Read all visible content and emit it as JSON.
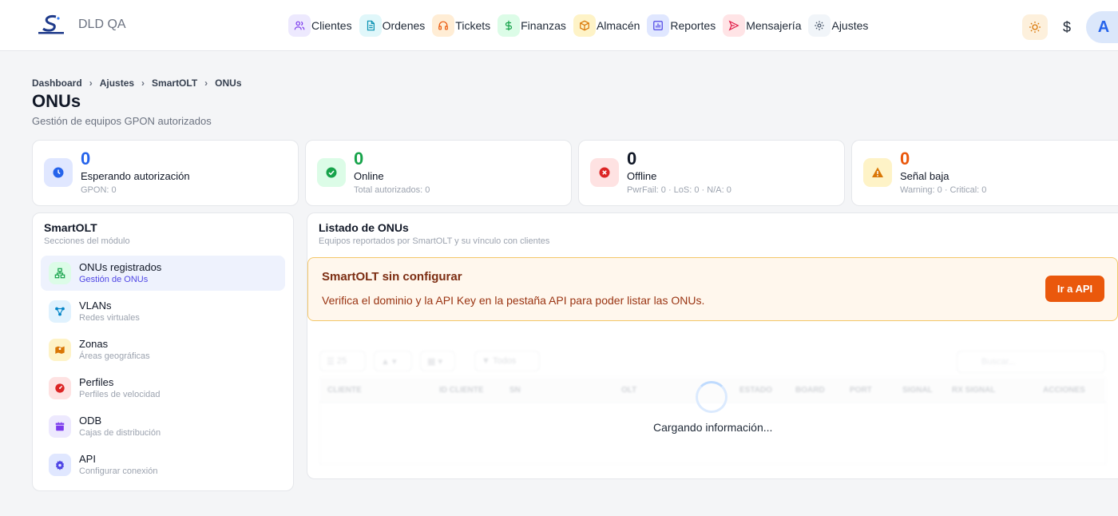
{
  "app": {
    "name": "DLD QA"
  },
  "nav": [
    {
      "label": "Clientes",
      "icon": "users-icon",
      "bg": "#ede9fe",
      "color": "#7c3aed"
    },
    {
      "label": "Ordenes",
      "icon": "document-icon",
      "bg": "#e0f7fa",
      "color": "#0891b2"
    },
    {
      "label": "Tickets",
      "icon": "headset-icon",
      "bg": "#ffedd5",
      "color": "#ea580c"
    },
    {
      "label": "Finanzas",
      "icon": "dollar-icon",
      "bg": "#dcfce7",
      "color": "#16a34a"
    },
    {
      "label": "Almacén",
      "icon": "box-icon",
      "bg": "#fef3c7",
      "color": "#d97706"
    },
    {
      "label": "Reportes",
      "icon": "bar-chart-icon",
      "bg": "#e0e7ff",
      "color": "#4f46e5"
    },
    {
      "label": "Mensajería",
      "icon": "send-icon",
      "bg": "#ffe4e6",
      "color": "#e11d48"
    },
    {
      "label": "Ajustes",
      "icon": "gear-icon",
      "bg": "#f1f5f9",
      "color": "#475569"
    }
  ],
  "topbar": {
    "dollar": "$",
    "avatar": "A"
  },
  "breadcrumb": [
    "Dashboard",
    "Ajustes",
    "SmartOLT",
    "ONUs"
  ],
  "page": {
    "title": "ONUs",
    "subtitle": "Gestión de equipos GPON autorizados"
  },
  "stats": [
    {
      "value": "0",
      "label": "Esperando autorización",
      "sub": "GPON: 0",
      "color": "#2563eb",
      "bg": "#e0e7ff",
      "icon": "clock-icon"
    },
    {
      "value": "0",
      "label": "Online",
      "sub": "Total autorizados: 0",
      "color": "#16a34a",
      "bg": "#dcfce7",
      "icon": "check-circle-icon"
    },
    {
      "value": "0",
      "label": "Offline",
      "sub": "PwrFail: 0 · LoS: 0 · N/A: 0",
      "color": "#111827",
      "bg": "#fee2e2",
      "icon": "x-circle-icon"
    },
    {
      "value": "0",
      "label": "Señal baja",
      "sub": "Warning: 0 · Critical: 0",
      "color": "#ea580c",
      "bg": "#fef3c7",
      "icon": "warning-icon"
    }
  ],
  "sidebar": {
    "title": "SmartOLT",
    "subtitle": "Secciones del módulo",
    "items": [
      {
        "label": "ONUs registrados",
        "sub": "Gestión de ONUs",
        "icon": "network-icon",
        "bg": "#dcfce7",
        "color": "#16a34a",
        "active": true
      },
      {
        "label": "VLANs",
        "sub": "Redes virtuales",
        "icon": "share-nodes-icon",
        "bg": "#e0f2fe",
        "color": "#0284c7",
        "active": false
      },
      {
        "label": "Zonas",
        "sub": "Áreas geográficas",
        "icon": "map-icon",
        "bg": "#fef3c7",
        "color": "#d97706",
        "active": false
      },
      {
        "label": "Perfiles",
        "sub": "Perfiles de velocidad",
        "icon": "gauge-icon",
        "bg": "#fee2e2",
        "color": "#dc2626",
        "active": false
      },
      {
        "label": "ODB",
        "sub": "Cajas de distribución",
        "icon": "box-icon",
        "bg": "#ede9fe",
        "color": "#7c3aed",
        "active": false
      },
      {
        "label": "API",
        "sub": "Configurar conexión",
        "icon": "gear-icon",
        "bg": "#e0e7ff",
        "color": "#4f46e5",
        "active": false
      }
    ]
  },
  "main": {
    "title": "Listado de ONUs",
    "subtitle": "Equipos reportados por SmartOLT y su vínculo con clientes",
    "alert": {
      "title": "SmartOLT sin configurar",
      "text": "Verifica el dominio y la API Key en la pestaña API para poder listar las ONUs.",
      "button": "Ir a API"
    },
    "table": {
      "page_size": "25",
      "filter": "Todos",
      "search_placeholder": "Buscar...",
      "columns": [
        "CLIENTE",
        "ID CLIENTE",
        "SN",
        "OLT",
        "ESTADO",
        "BOARD",
        "PORT",
        "SIGNAL",
        "RX SIGNAL",
        "ACCIONES"
      ]
    },
    "loading": "Cargando información..."
  }
}
